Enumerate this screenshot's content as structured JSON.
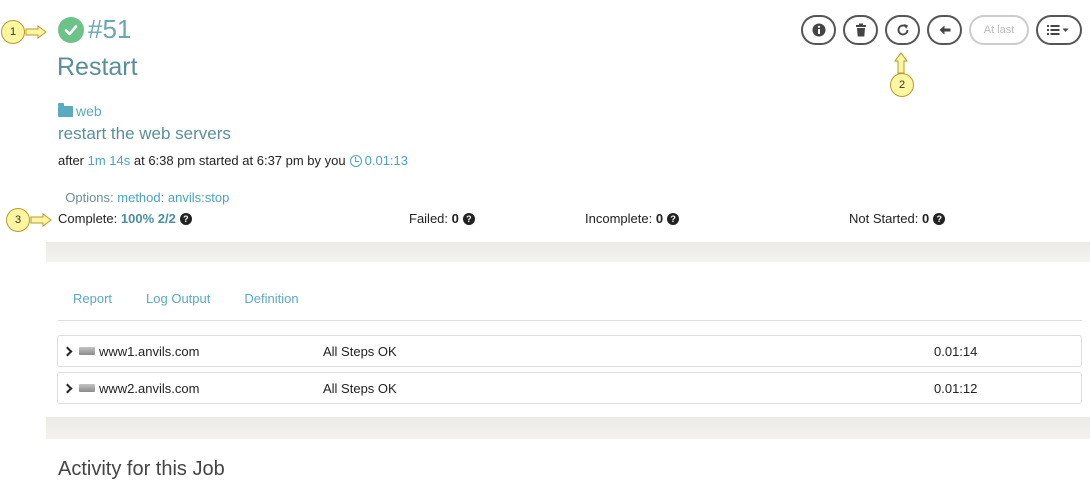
{
  "callouts": [
    "1",
    "2",
    "3"
  ],
  "job": {
    "number": "#51",
    "name": "Restart",
    "group": "web",
    "description": "restart the web servers",
    "timing": {
      "after": "after ",
      "after_value": "1m 14s",
      "at": " at 6:38 pm started at 6:37 pm by you",
      "duration": "0.01:13"
    },
    "options": {
      "label": "Options: ",
      "key": "method",
      "sep": ": ",
      "value": "anvils:stop"
    }
  },
  "stats": {
    "complete_label": "Complete: ",
    "complete_value": "100% 2/2",
    "failed_label": "Failed: ",
    "failed_value": "0",
    "incomplete_label": "Incomplete: ",
    "incomplete_value": "0",
    "not_started_label": "Not Started: ",
    "not_started_value": "0"
  },
  "toolbar": {
    "at_last_label": "At last",
    "icons": [
      "info-icon",
      "trash-icon",
      "refresh-icon",
      "arrow-left-icon",
      "list-menu-icon"
    ]
  },
  "tabs": [
    "Report",
    "Log Output",
    "Definition"
  ],
  "nodes": [
    {
      "host": "www1.anvils.com",
      "status": "All Steps OK",
      "duration": "0.01:14"
    },
    {
      "host": "www2.anvils.com",
      "status": "All Steps OK",
      "duration": "0.01:12"
    }
  ],
  "activity_title": "Activity for this Job",
  "colors": {
    "success": "#6cc387",
    "link": "#4aa3c2",
    "title": "#5a8f99"
  }
}
